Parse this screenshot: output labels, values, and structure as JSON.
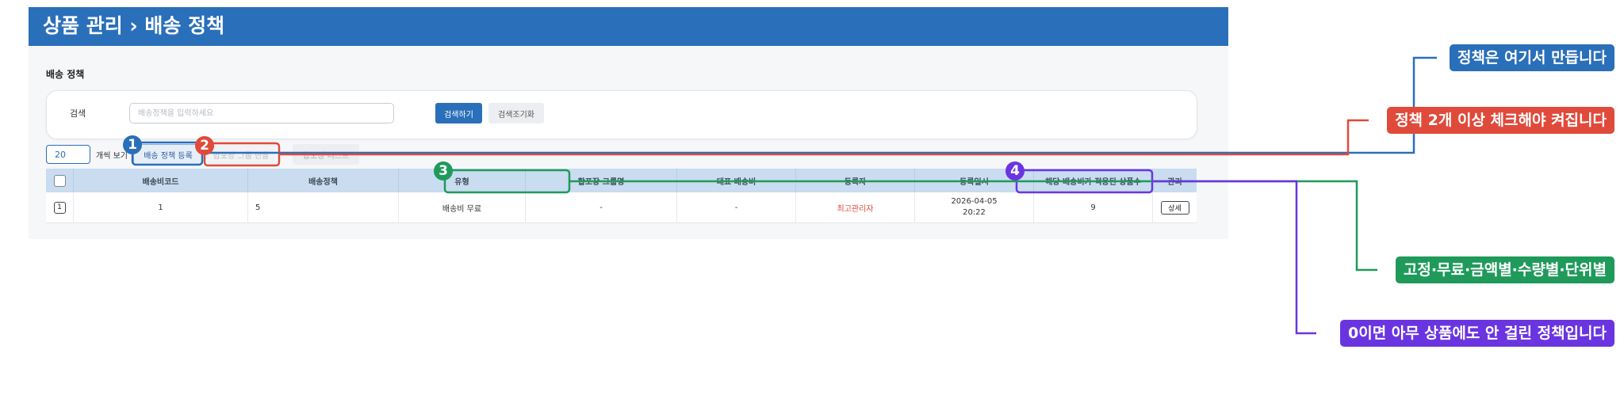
{
  "header": {
    "title": "상품 관리 › 배송 정책"
  },
  "section_title": "배송 정책",
  "search": {
    "label": "검색",
    "placeholder": "배송정책을 입력하세요",
    "submit_label": "검색하기",
    "reset_label": "검색조기화"
  },
  "toolbar": {
    "page_size": "20",
    "page_size_suffix": "개씩 보기",
    "register_label": "배송 정책 등록",
    "group_make_label": "합포장 그룹 만들",
    "group_list_label": "합포장 리스트"
  },
  "table": {
    "columns": [
      "배송비코드",
      "배송정책",
      "유형",
      "합포장 그룹명",
      "대표 배송비",
      "등록자",
      "등록일시",
      "해당 배송비가 적용된 상품수",
      "관리"
    ],
    "rows": [
      {
        "check": "1",
        "code": "1",
        "policy": "5",
        "type": "배송비 무료",
        "group_name": "-",
        "rep_fee": "-",
        "registrant": "최고관리자",
        "date_line1": "2026-04-05",
        "date_line2": "20:22",
        "product_count": "9",
        "action": "상세"
      }
    ]
  },
  "annotations": {
    "markers": [
      "1",
      "2",
      "3",
      "4"
    ],
    "callouts": [
      {
        "text": "정책은 여기서 만듭니다",
        "color": "#2a6fba"
      },
      {
        "text": "정책 2개 이상 체크해야 켜집니다",
        "color": "#e04a3b"
      },
      {
        "text": "고정·무료·금액별·수량별·단위별",
        "color": "#1f9a5a"
      },
      {
        "text": "0이면 아무 상품에도 안 걸린 정책입니다",
        "color": "#6a35e0"
      }
    ]
  },
  "colors": {
    "primary": "#2a6fba",
    "header_bar": "#2a6fba",
    "table_header": "#c9dcf0",
    "annotation_blue": "#2a6fba",
    "annotation_red": "#e04a3b",
    "annotation_green": "#1f9a5a",
    "annotation_purple": "#6a35e0",
    "registrant_text": "#e04a3b"
  }
}
